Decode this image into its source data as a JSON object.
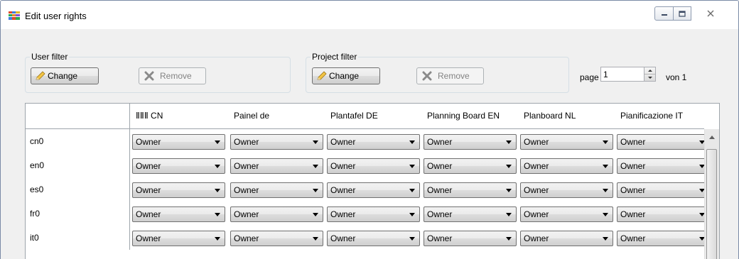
{
  "window": {
    "title": "Edit user rights",
    "icon": "app-grid-icon",
    "controls": [
      "minimize-icon",
      "maximize-icon",
      "close-icon"
    ]
  },
  "user_filter": {
    "legend": "User filter",
    "change_label": "Change",
    "remove_label": "Remove"
  },
  "project_filter": {
    "legend": "Project filter",
    "change_label": "Change",
    "remove_label": "Remove"
  },
  "paging": {
    "page_label": "page",
    "page_value": "1",
    "of_label": "von 1"
  },
  "grid": {
    "columns": [
      "ⅡⅡⅡ CN",
      "Painel de",
      "Plantafel DE",
      "Planning Board EN",
      "Planboard NL",
      "Pianificazione IT"
    ],
    "rows": [
      {
        "user": "cn0",
        "values": [
          "Owner",
          "Owner",
          "Owner",
          "Owner",
          "Owner",
          "Owner"
        ]
      },
      {
        "user": "en0",
        "values": [
          "Owner",
          "Owner",
          "Owner",
          "Owner",
          "Owner",
          "Owner"
        ]
      },
      {
        "user": "es0",
        "values": [
          "Owner",
          "Owner",
          "Owner",
          "Owner",
          "Owner",
          "Owner"
        ]
      },
      {
        "user": "fr0",
        "values": [
          "Owner",
          "Owner",
          "Owner",
          "Owner",
          "Owner",
          "Owner"
        ]
      },
      {
        "user": "it0",
        "values": [
          "Owner",
          "Owner",
          "Owner",
          "Owner",
          "Owner",
          "Owner"
        ]
      }
    ]
  },
  "colors": {
    "window_bg": "#f0f0f0",
    "grid_bg": "#ffffff",
    "border": "#9ea5ab"
  }
}
